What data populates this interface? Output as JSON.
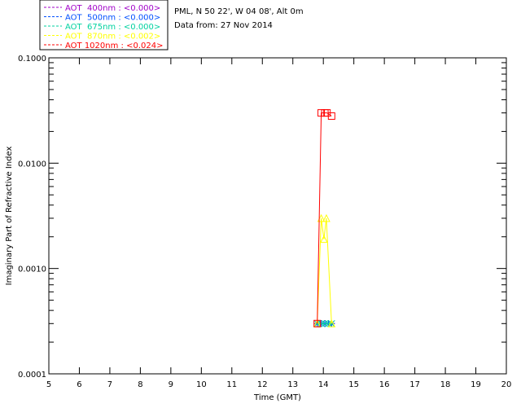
{
  "info": {
    "site": "PML, N 50 22', W 04 08', Alt 0m",
    "date": "Data from: 27 Nov 2014"
  },
  "chart_data": {
    "type": "line",
    "xlabel": "Time (GMT)",
    "ylabel": "Imaginary Part of Refractive Index",
    "xlim": [
      5,
      20
    ],
    "ylim": [
      0.0001,
      0.1
    ],
    "yscale": "log",
    "xticks": [
      5,
      6,
      7,
      8,
      9,
      10,
      11,
      12,
      13,
      14,
      15,
      16,
      17,
      18,
      19,
      20
    ],
    "xtick_labels": [
      "5",
      "6",
      "7",
      "8",
      "9",
      "10",
      "11",
      "12",
      "13",
      "14",
      "15",
      "16",
      "17",
      "18",
      "19",
      "20"
    ],
    "yticks": [
      0.0001,
      0.001,
      0.01,
      0.1
    ],
    "ytick_labels": [
      "0.0001",
      "0.0010",
      "0.0100",
      "0.1000"
    ],
    "grid": false,
    "legend_position": "top-left, outside plot",
    "series": [
      {
        "name": "AOT  400nm : <0.000>",
        "color": "#a000c8",
        "marker": "cross",
        "x": [
          13.8,
          13.93,
          14.05,
          14.17,
          14.27
        ],
        "y": [
          0.0003,
          0.0003,
          0.0003,
          0.0003,
          0.0003
        ]
      },
      {
        "name": "AOT  500nm : <0.000>",
        "color": "#0050ff",
        "marker": "asterisk",
        "x": [
          13.8,
          13.93,
          14.05,
          14.17,
          14.27
        ],
        "y": [
          0.0003,
          0.0003,
          0.0003,
          0.0003,
          0.0003
        ]
      },
      {
        "name": "AOT  675nm : <0.000>",
        "color": "#00d2a0",
        "marker": "x",
        "x": [
          13.8,
          13.93,
          14.05,
          14.17,
          14.27
        ],
        "y": [
          0.0003,
          0.0003,
          0.0003,
          0.0003,
          0.0003
        ]
      },
      {
        "name": "AOT  870nm : <0.002>",
        "color": "#ffff00",
        "marker": "triangle",
        "x": [
          13.8,
          13.93,
          14.02,
          14.1,
          14.27
        ],
        "y": [
          0.0003,
          0.003,
          0.0019,
          0.003,
          0.0003
        ]
      },
      {
        "name": "AOT 1020nm : <0.024>",
        "color": "#ff0000",
        "marker": "square",
        "x": [
          13.8,
          13.93,
          14.05,
          14.12,
          14.27
        ],
        "y": [
          0.0003,
          0.03,
          0.03,
          0.03,
          0.028
        ]
      }
    ]
  }
}
